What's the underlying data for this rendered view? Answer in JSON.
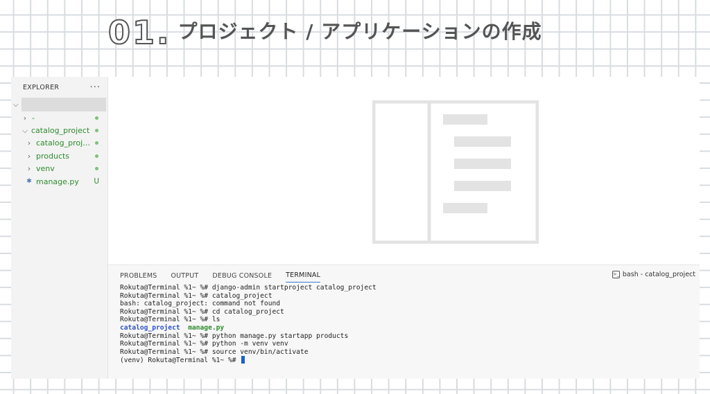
{
  "slide": {
    "number": "01.",
    "title": "プロジェクト / アプリケーションの作成"
  },
  "explorer": {
    "header": "EXPLORER",
    "more": "···",
    "items": [
      {
        "label": "-",
        "type": "folder",
        "expanded": false,
        "status": "dot"
      },
      {
        "label": "catalog_project",
        "type": "folder",
        "expanded": true,
        "status": "dot"
      },
      {
        "label": "catalog_proje...",
        "type": "folder",
        "expanded": false,
        "status": "dot"
      },
      {
        "label": "products",
        "type": "folder",
        "expanded": false,
        "status": "dot"
      },
      {
        "label": "venv",
        "type": "folder",
        "expanded": false,
        "status": "dot"
      },
      {
        "label": "manage.py",
        "type": "file",
        "status": "U"
      }
    ]
  },
  "panel": {
    "tabs": [
      {
        "label": "PROBLEMS",
        "active": false
      },
      {
        "label": "OUTPUT",
        "active": false
      },
      {
        "label": "DEBUG CONSOLE",
        "active": false
      },
      {
        "label": "TERMINAL",
        "active": true
      }
    ],
    "terminal_title": "bash - catalog_project",
    "lines": [
      "Rokuta@Terminal %1~ %# django-admin startproject catalog_project",
      "Rokuta@Terminal %1~ %# catalog_project",
      "bash: catalog_project: command not found",
      "Rokuta@Terminal %1~ %# cd catalog_project",
      "Rokuta@Terminal %1~ %# ls"
    ],
    "ls_output": {
      "dir": "catalog_project",
      "file": "manage.py"
    },
    "lines_after": [
      "Rokuta@Terminal %1~ %# python manage.py startapp products",
      "Rokuta@Terminal %1~ %# python -m venv venv",
      "Rokuta@Terminal %1~ %# source venv/bin/activate"
    ],
    "prompt": "(venv) Rokuta@Terminal %1~ %# "
  },
  "colors": {
    "accent": "#3a7bd5",
    "git_green": "#2e8b2e",
    "dir_blue": "#2c52c8",
    "cursor": "#1a5fd1"
  }
}
